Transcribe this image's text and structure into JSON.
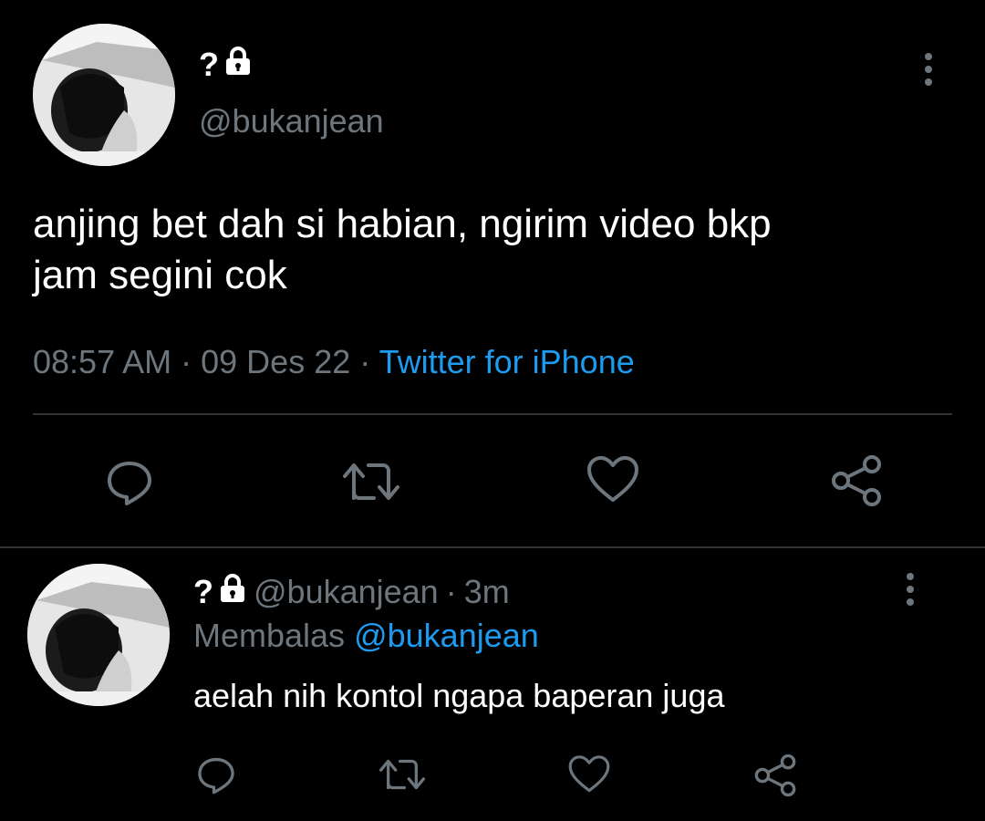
{
  "colors": {
    "background": "#000000",
    "text": "#ffffff",
    "muted": "#6e767d",
    "link": "#1d9bf0",
    "divider": "#2f3336"
  },
  "main_tweet": {
    "display_name": "?",
    "handle": "@bukanjean",
    "text_line1": "anjing bet dah si habian, ngirim video bkp",
    "text_line2": "jam segini cok",
    "time": "08:57 AM",
    "date": "09 Des 22",
    "source": "Twitter for iPhone",
    "separator": "·",
    "icons": [
      "more-vertical-icon",
      "reply-icon",
      "retweet-icon",
      "like-icon",
      "share-icon"
    ]
  },
  "reply_tweet": {
    "display_name": "?",
    "handle": "@bukanjean",
    "separator": "·",
    "age": "3m",
    "replying_label": "Membalas",
    "replying_to": "@bukanjean",
    "text": "aelah nih kontol ngapa baperan juga",
    "icons": [
      "more-vertical-icon",
      "reply-icon",
      "retweet-icon",
      "like-icon",
      "share-icon"
    ]
  }
}
